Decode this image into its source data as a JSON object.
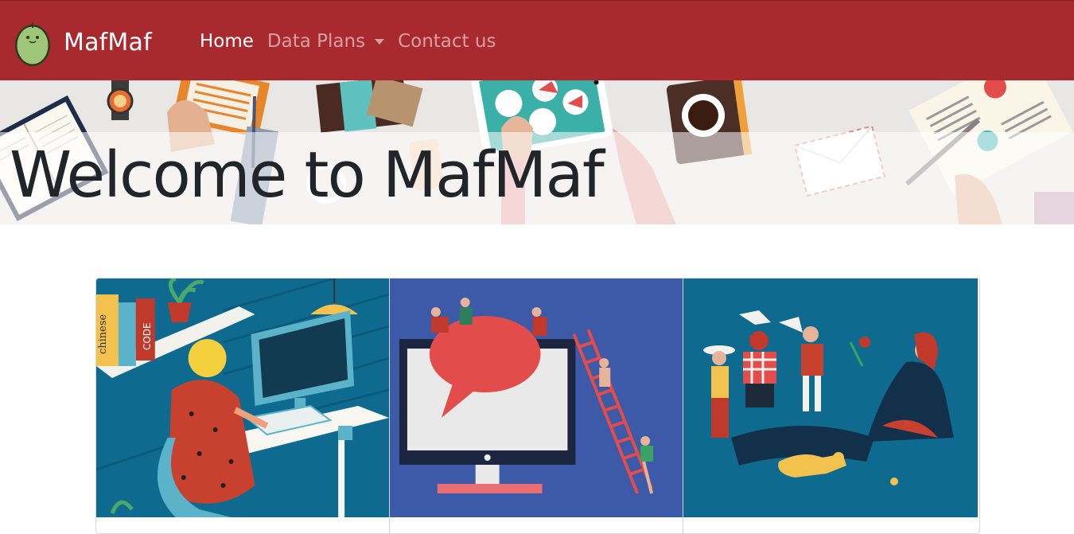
{
  "navbar": {
    "brand": "MafMaf",
    "logo_icon": "avocado-icon",
    "items": [
      {
        "label": "Home",
        "active": true
      },
      {
        "label": "Data Plans",
        "dropdown": true
      },
      {
        "label": "Contact us"
      }
    ],
    "background": "#a92a2e"
  },
  "hero": {
    "title": "Welcome to MafMaf"
  },
  "cards": [
    {
      "image": "woman-at-computer-illustration"
    },
    {
      "image": "people-climbing-monitor-chat-bubble-illustration"
    },
    {
      "image": "people-celebrating-illustration"
    }
  ]
}
